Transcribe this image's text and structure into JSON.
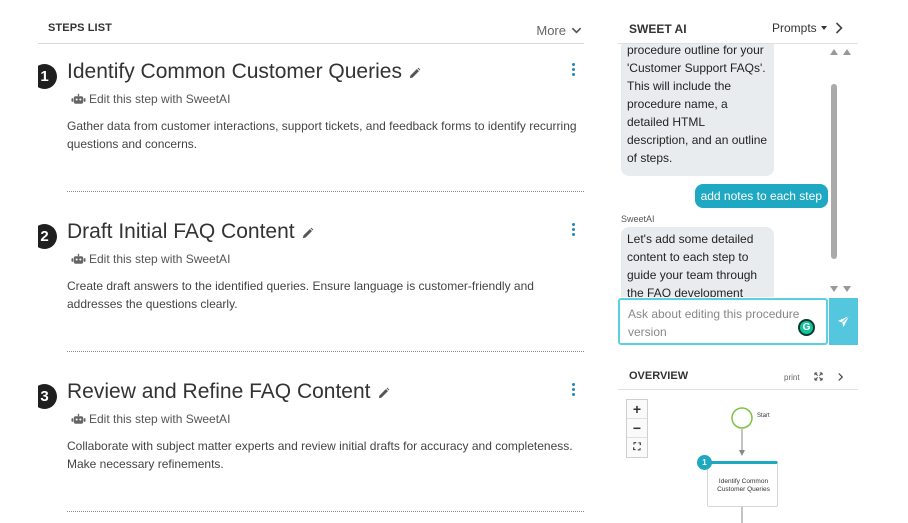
{
  "steps_panel": {
    "title": "STEPS LIST",
    "more_label": "More",
    "steps": [
      {
        "number": "1",
        "title": "Identify Common Customer Queries",
        "edit_label": "Edit this step with SweetAI",
        "description": "Gather data from customer interactions, support tickets, and feedback forms to identify recurring questions and concerns."
      },
      {
        "number": "2",
        "title": "Draft Initial FAQ Content",
        "edit_label": "Edit this step with SweetAI",
        "description": "Create draft answers to the identified queries. Ensure language is customer-friendly and addresses the questions clearly."
      },
      {
        "number": "3",
        "title": "Review and Refine FAQ Content",
        "edit_label": "Edit this step with SweetAI",
        "description": "Collaborate with subject matter experts and review initial drafts for accuracy and completeness. Make necessary refinements."
      }
    ]
  },
  "sweet_ai": {
    "title": "SWEET AI",
    "prompts_label": "Prompts",
    "messages": [
      {
        "role": "assistant",
        "text": "procedure outline for your 'Customer Support FAQs'. This will include the procedure name, a detailed HTML description, and an outline of steps."
      },
      {
        "role": "user",
        "text": "add notes to each step"
      },
      {
        "role": "assistant",
        "sender": "SweetAI",
        "text": "Let's add some detailed content to each step to guide your team through the FAQ development"
      }
    ],
    "input_placeholder": "Ask about editing this procedure version",
    "grammarly_letter": "G"
  },
  "overview": {
    "title": "OVERVIEW",
    "print_label": "print",
    "zoom_in": "+",
    "zoom_out": "−",
    "fit_label": "⛶",
    "start_label": "Start",
    "node_number": "1",
    "node_label": "Identify Common Customer Queries"
  },
  "colors": {
    "accent": "#1ea8c2",
    "send_button": "#54c6de",
    "link_blue": "#1e88c9",
    "start_circle": "#7cc242"
  }
}
